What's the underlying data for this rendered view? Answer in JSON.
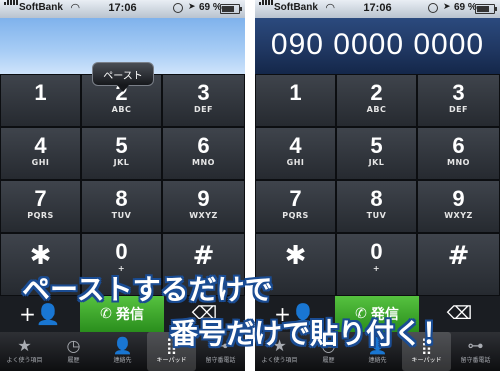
{
  "status": {
    "carrier": "SoftBank",
    "time": "17:06",
    "battery": "69 %"
  },
  "left_phone": {
    "popup": "ペースト"
  },
  "right_phone": {
    "number": "090 0000 0000"
  },
  "keys": [
    {
      "digit": "1",
      "letters": ""
    },
    {
      "digit": "2",
      "letters": "ABC"
    },
    {
      "digit": "3",
      "letters": "DEF"
    },
    {
      "digit": "4",
      "letters": "GHI"
    },
    {
      "digit": "5",
      "letters": "JKL"
    },
    {
      "digit": "6",
      "letters": "MNO"
    },
    {
      "digit": "7",
      "letters": "PQRS"
    },
    {
      "digit": "8",
      "letters": "TUV"
    },
    {
      "digit": "9",
      "letters": "WXYZ"
    },
    {
      "digit": "✱",
      "letters": ""
    },
    {
      "digit": "0",
      "letters": "+"
    },
    {
      "digit": "#",
      "letters": ""
    }
  ],
  "call_label": "発信",
  "tabs": [
    {
      "label": "よく使う項目",
      "icon": "star-icon"
    },
    {
      "label": "履歴",
      "icon": "clock-icon"
    },
    {
      "label": "連絡先",
      "icon": "person-icon"
    },
    {
      "label": "キーパッド",
      "icon": "keypad-icon"
    },
    {
      "label": "留守番電話",
      "icon": "voicemail-icon"
    }
  ],
  "caption": {
    "line1": "ペーストするだけで",
    "line2": "番号だけで貼り付く！"
  },
  "colors": {
    "call_green": "#3aa52a",
    "caption_outline": "#1a4c93"
  }
}
